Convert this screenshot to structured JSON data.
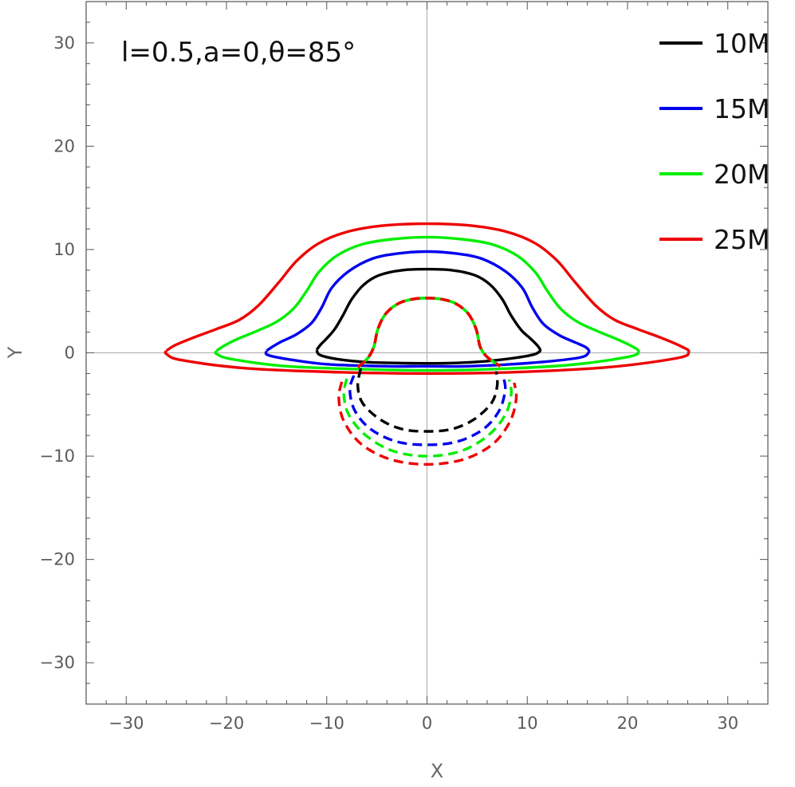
{
  "chart_data": {
    "type": "line",
    "title": "",
    "xlabel": "X",
    "ylabel": "Y",
    "xlim": [
      -34,
      34
    ],
    "ylim": [
      -34,
      34
    ],
    "xticks": [
      -30,
      -20,
      -10,
      0,
      10,
      20,
      30
    ],
    "yticks": [
      -30,
      -20,
      -10,
      0,
      10,
      20,
      30
    ],
    "tick_labels_x": [
      "−30",
      "−20",
      "−10",
      "0",
      "10",
      "20",
      "30"
    ],
    "tick_labels_y": [
      "−30",
      "−20",
      "−10",
      "0",
      "10",
      "20",
      "30"
    ],
    "grid": false,
    "annotation": "l=0.5,a=0,θ=85°",
    "legend_position": "top-right",
    "series": [
      {
        "name": "10M",
        "color": "#000000",
        "direct": [
          [
            -11,
            0.3
          ],
          [
            -10.6,
            0.8
          ],
          [
            -10,
            1.4
          ],
          [
            -9.2,
            2.3
          ],
          [
            -8.4,
            3.6
          ],
          [
            -7.5,
            5.2
          ],
          [
            -6.3,
            6.6
          ],
          [
            -4.8,
            7.5
          ],
          [
            -2.5,
            8.0
          ],
          [
            0,
            8.1
          ],
          [
            2.5,
            8.0
          ],
          [
            4.8,
            7.5
          ],
          [
            6.3,
            6.6
          ],
          [
            7.5,
            5.2
          ],
          [
            8.4,
            3.6
          ],
          [
            9.4,
            2.2
          ],
          [
            10.3,
            1.4
          ],
          [
            11.1,
            0.6
          ],
          [
            11.2,
            0.1
          ],
          [
            10,
            -0.3
          ],
          [
            6,
            -0.8
          ],
          [
            2,
            -1.0
          ],
          [
            -2,
            -1.0
          ],
          [
            -6,
            -0.9
          ],
          [
            -9,
            -0.6
          ],
          [
            -10.7,
            -0.2
          ],
          [
            -11,
            0.3
          ]
        ],
        "secondary": [
          [
            -6.6,
            -1.5
          ],
          [
            -6.9,
            -3.2
          ],
          [
            -6.4,
            -4.9
          ],
          [
            -4.6,
            -6.5
          ],
          [
            -2.4,
            -7.4
          ],
          [
            0,
            -7.6
          ],
          [
            2.4,
            -7.4
          ],
          [
            4.6,
            -6.5
          ],
          [
            6.4,
            -4.9
          ],
          [
            7.0,
            -3.2
          ],
          [
            6.9,
            -1.8
          ]
        ]
      },
      {
        "name": "15M",
        "color": "#0000ee",
        "direct": [
          [
            -16,
            0.2
          ],
          [
            -15.4,
            0.6
          ],
          [
            -14.5,
            1.1
          ],
          [
            -13,
            1.8
          ],
          [
            -11.5,
            2.9
          ],
          [
            -10.5,
            4.4
          ],
          [
            -9.5,
            6.3
          ],
          [
            -7.8,
            7.9
          ],
          [
            -5.5,
            9.1
          ],
          [
            -3,
            9.6
          ],
          [
            0,
            9.8
          ],
          [
            3,
            9.6
          ],
          [
            5.5,
            9.1
          ],
          [
            7.8,
            7.9
          ],
          [
            9.5,
            6.3
          ],
          [
            10.5,
            4.4
          ],
          [
            11.6,
            2.8
          ],
          [
            13.2,
            1.7
          ],
          [
            14.8,
            1.0
          ],
          [
            15.9,
            0.5
          ],
          [
            16.1,
            0.0
          ],
          [
            15,
            -0.5
          ],
          [
            10,
            -1.0
          ],
          [
            4,
            -1.3
          ],
          [
            0,
            -1.3
          ],
          [
            -4,
            -1.3
          ],
          [
            -10,
            -1.1
          ],
          [
            -14,
            -0.6
          ],
          [
            -15.9,
            -0.2
          ],
          [
            -16,
            0.2
          ]
        ],
        "secondary": [
          [
            -7.3,
            -2.2
          ],
          [
            -7.7,
            -3.6
          ],
          [
            -7.2,
            -5.6
          ],
          [
            -5.6,
            -7.4
          ],
          [
            -3,
            -8.6
          ],
          [
            0,
            -8.9
          ],
          [
            3,
            -8.6
          ],
          [
            5.6,
            -7.4
          ],
          [
            7.2,
            -5.6
          ],
          [
            7.8,
            -3.6
          ],
          [
            7.6,
            -2.3
          ]
        ]
      },
      {
        "name": "20M",
        "color": "#00ee00",
        "direct": [
          [
            -21,
            0.2
          ],
          [
            -20.2,
            0.7
          ],
          [
            -19,
            1.3
          ],
          [
            -17,
            2.1
          ],
          [
            -15,
            3.0
          ],
          [
            -13.3,
            4.3
          ],
          [
            -12,
            6.0
          ],
          [
            -10.8,
            7.8
          ],
          [
            -9,
            9.4
          ],
          [
            -6.5,
            10.5
          ],
          [
            -3.5,
            11.0
          ],
          [
            0,
            11.2
          ],
          [
            3.5,
            11.0
          ],
          [
            6.5,
            10.5
          ],
          [
            9,
            9.4
          ],
          [
            10.8,
            7.8
          ],
          [
            12,
            6.0
          ],
          [
            13.3,
            4.3
          ],
          [
            15,
            3.0
          ],
          [
            17,
            2.1
          ],
          [
            19,
            1.3
          ],
          [
            20.5,
            0.6
          ],
          [
            21.1,
            0.1
          ],
          [
            20,
            -0.4
          ],
          [
            14,
            -1.2
          ],
          [
            6,
            -1.6
          ],
          [
            0,
            -1.7
          ],
          [
            -6,
            -1.6
          ],
          [
            -14,
            -1.3
          ],
          [
            -19.5,
            -0.6
          ],
          [
            -21,
            -0.1
          ],
          [
            -21,
            0.2
          ]
        ],
        "secondary": [
          [
            -8,
            -2.5
          ],
          [
            -8.3,
            -4.0
          ],
          [
            -7.8,
            -6.0
          ],
          [
            -6.1,
            -8.0
          ],
          [
            -3.4,
            -9.5
          ],
          [
            0,
            -10.0
          ],
          [
            3.4,
            -9.5
          ],
          [
            6.1,
            -8.0
          ],
          [
            7.8,
            -6.0
          ],
          [
            8.4,
            -4.0
          ],
          [
            8.2,
            -2.6
          ]
        ]
      },
      {
        "name": "25M",
        "color": "#ee0000",
        "direct": [
          [
            -26,
            0.2
          ],
          [
            -25.2,
            0.7
          ],
          [
            -23.5,
            1.4
          ],
          [
            -21,
            2.3
          ],
          [
            -18.7,
            3.2
          ],
          [
            -16.8,
            4.6
          ],
          [
            -14.8,
            6.8
          ],
          [
            -13,
            8.9
          ],
          [
            -10.8,
            10.6
          ],
          [
            -8,
            11.7
          ],
          [
            -4.5,
            12.3
          ],
          [
            0,
            12.5
          ],
          [
            4.5,
            12.3
          ],
          [
            8,
            11.7
          ],
          [
            10.8,
            10.6
          ],
          [
            13,
            8.9
          ],
          [
            14.8,
            6.8
          ],
          [
            16.8,
            4.6
          ],
          [
            18.7,
            3.2
          ],
          [
            21,
            2.3
          ],
          [
            23.5,
            1.4
          ],
          [
            25.4,
            0.6
          ],
          [
            26.1,
            0.1
          ],
          [
            25,
            -0.5
          ],
          [
            18,
            -1.4
          ],
          [
            8,
            -1.9
          ],
          [
            0,
            -2.0
          ],
          [
            -8,
            -1.9
          ],
          [
            -18,
            -1.5
          ],
          [
            -24.5,
            -0.7
          ],
          [
            -26,
            -0.1
          ],
          [
            -26,
            0.2
          ]
        ],
        "secondary": [
          [
            -8.5,
            -2.8
          ],
          [
            -8.8,
            -4.4
          ],
          [
            -8.3,
            -6.6
          ],
          [
            -6.6,
            -8.8
          ],
          [
            -3.7,
            -10.3
          ],
          [
            0,
            -10.8
          ],
          [
            3.7,
            -10.3
          ],
          [
            6.6,
            -8.8
          ],
          [
            8.3,
            -6.6
          ],
          [
            8.9,
            -4.4
          ],
          [
            8.7,
            -2.9
          ]
        ]
      }
    ],
    "shared_dashed_arc": {
      "colors": [
        "#00ee00",
        "#ee0000"
      ],
      "points": [
        [
          -6.9,
          -1.4
        ],
        [
          -5.9,
          -0.5
        ],
        [
          -5.3,
          0.6
        ],
        [
          -4.9,
          2.3
        ],
        [
          -4.1,
          3.8
        ],
        [
          -2.8,
          4.8
        ],
        [
          -1.4,
          5.2
        ],
        [
          0,
          5.3
        ],
        [
          1.4,
          5.2
        ],
        [
          2.8,
          4.8
        ],
        [
          4.1,
          3.8
        ],
        [
          4.9,
          2.3
        ],
        [
          5.3,
          0.6
        ],
        [
          6.0,
          -0.4
        ],
        [
          7.3,
          -1.3
        ]
      ]
    }
  }
}
